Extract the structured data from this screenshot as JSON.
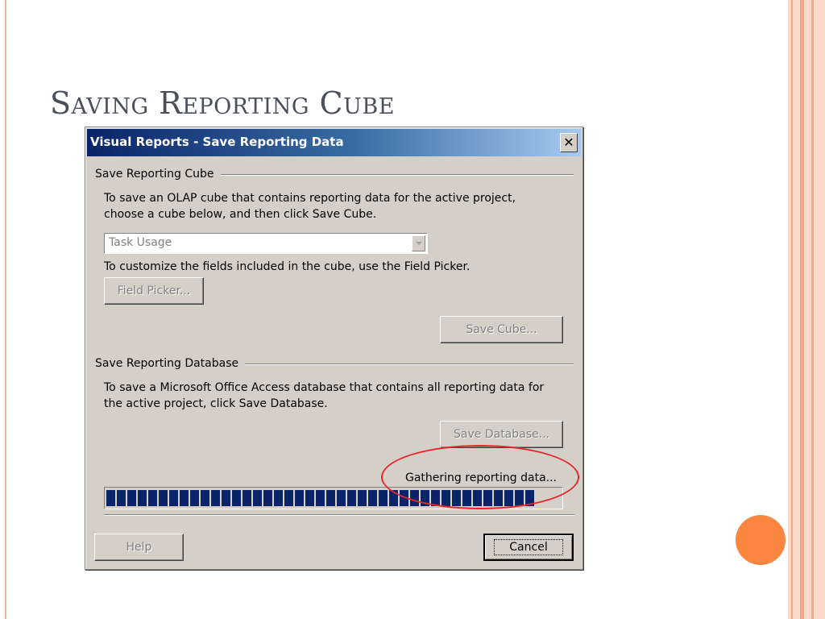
{
  "slide": {
    "title": "Saving Reporting Cube",
    "colors": {
      "accent": "#fb8640",
      "stripe": "#f4a98a",
      "band": "#fbd9c9",
      "title_text": "#4a4f5a"
    }
  },
  "dialog": {
    "title": "Visual Reports - Save Reporting Data",
    "close_label": "✕",
    "cube_section": {
      "heading": "Save Reporting Cube",
      "instructions": [
        "To save an OLAP cube that contains reporting data for the active project,",
        "choose a cube below, and then click Save Cube."
      ],
      "cube_select_value": "Task Usage",
      "field_hint": "To customize the fields included in the cube, use the Field Picker.",
      "field_picker_label": "Field Picker...",
      "save_cube_label": "Save Cube..."
    },
    "database_section": {
      "heading": "Save Reporting Database",
      "instructions": [
        "To save a Microsoft Office Access database that contains all reporting data for",
        "the active project, click Save Database."
      ],
      "save_database_label": "Save Database..."
    },
    "status": "Gathering reporting data...",
    "progress": {
      "fraction": 0.96,
      "color": "#0a246a"
    },
    "help_label": "Help",
    "cancel_label": "Cancel"
  },
  "annotation": {
    "color": "#e8262c"
  }
}
